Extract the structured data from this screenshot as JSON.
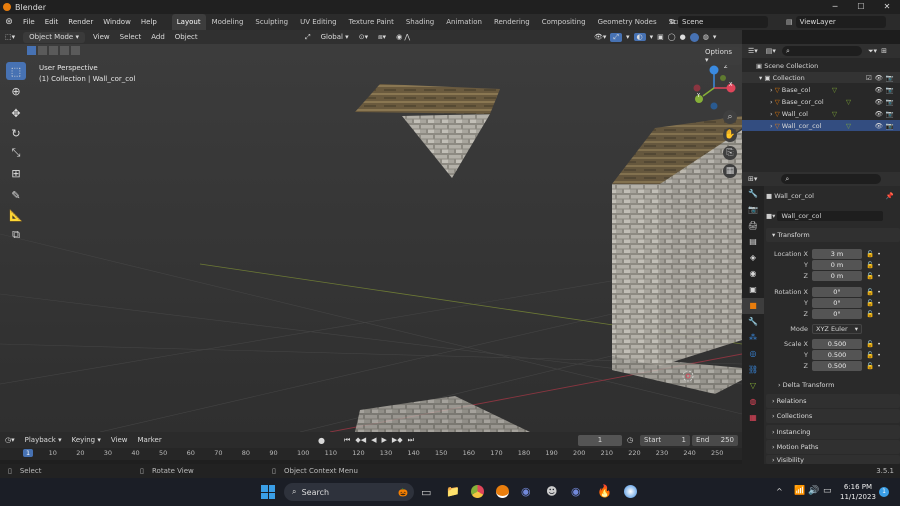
{
  "window": {
    "title": "Blender",
    "minimize": "─",
    "maximize": "☐",
    "close": "✕"
  },
  "menu": [
    "File",
    "Edit",
    "Render",
    "Window",
    "Help"
  ],
  "workspaces": [
    "Layout",
    "Modeling",
    "Sculpting",
    "UV Editing",
    "Texture Paint",
    "Shading",
    "Animation",
    "Rendering",
    "Compositing",
    "Geometry Nodes",
    "Scripting"
  ],
  "add_workspace": "+",
  "scene": "Scene",
  "view_layer": "ViewLayer",
  "toolbar": {
    "mode": "Object Mode",
    "view": "View",
    "select": "Select",
    "add": "Add",
    "object": "Object",
    "transform_orientation": "Global",
    "options": "Options"
  },
  "viewport": {
    "perspective": "User Perspective",
    "collection_info": "(1) Collection | Wall_cor_col",
    "axis_x": "X",
    "axis_y": "Y",
    "axis_z": "Z"
  },
  "outliner": {
    "search_placeholder": "",
    "scene_collection": "Scene Collection",
    "collection": "Collection",
    "items": [
      "Base_col",
      "Base_cor_col",
      "Wall_col",
      "Wall_cor_col"
    ]
  },
  "properties": {
    "object_name": "Wall_cor_col",
    "data_name": "Wall_cor_col",
    "transform": "Transform",
    "location_label": "Location X",
    "rotation_label": "Rotation X",
    "scale_label": "Scale X",
    "y_label": "Y",
    "z_label": "Z",
    "location": [
      "3 m",
      "0 m",
      "0 m"
    ],
    "rotation": [
      "0°",
      "0°",
      "0°"
    ],
    "mode_label": "Mode",
    "mode_value": "XYZ Euler",
    "scale": [
      "0.500",
      "0.500",
      "0.500"
    ],
    "delta_transform": "Delta Transform",
    "sections": [
      "Relations",
      "Collections",
      "Instancing",
      "Motion Paths",
      "Visibility"
    ]
  },
  "timeline": {
    "playback": "Playback",
    "keying": "Keying",
    "view": "View",
    "marker": "Marker",
    "current_frame": "1",
    "start_label": "Start",
    "start": "1",
    "end_label": "End",
    "end": "250",
    "ticks": [
      "1",
      "10",
      "20",
      "30",
      "40",
      "50",
      "60",
      "70",
      "80",
      "90",
      "100",
      "110",
      "120",
      "130",
      "140",
      "150",
      "160",
      "170",
      "180",
      "190",
      "200",
      "210",
      "220",
      "230",
      "240",
      "250"
    ]
  },
  "status": {
    "select": "Select",
    "rotate": "Rotate View",
    "context": "Object Context Menu",
    "version": "3.5.1"
  },
  "taskbar": {
    "search": "Search",
    "time": "6:16 PM",
    "date": "11/1/2023",
    "notifications": "1"
  },
  "colors": {
    "accent": "#4772b3",
    "orange": "#e87d0d",
    "axis_x": "#e0455a",
    "axis_y": "#86b038",
    "axis_z": "#3a8ae0"
  }
}
